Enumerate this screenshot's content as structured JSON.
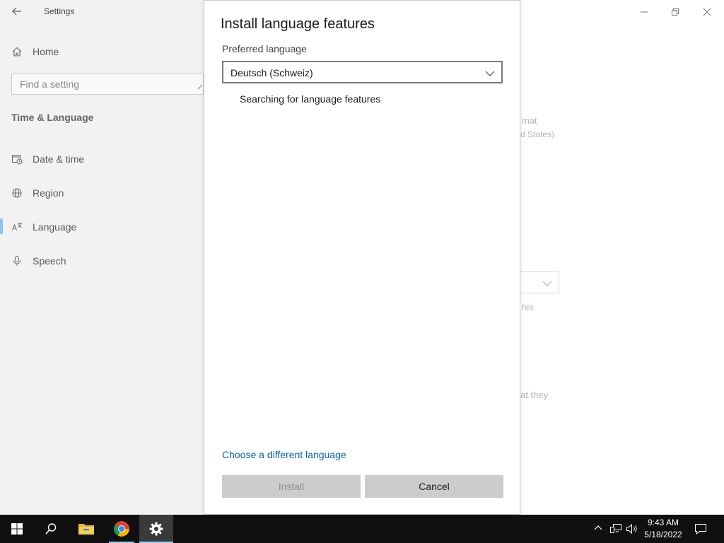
{
  "app": {
    "title": "Settings",
    "home_label": "Home",
    "search_placeholder": "Find a setting",
    "section_title": "Time & Language",
    "nav": [
      {
        "label": "Date & time",
        "icon": "calendar-clock-icon"
      },
      {
        "label": "Region",
        "icon": "globe-icon"
      },
      {
        "label": "Language",
        "icon": "language-icon"
      },
      {
        "label": "Speech",
        "icon": "microphone-icon"
      }
    ],
    "selected_nav": "Language"
  },
  "background_fragments": {
    "line1": "mat",
    "line2": "d States)",
    "line3": "his",
    "line4": "at they"
  },
  "dialog": {
    "title": "Install language features",
    "preferred_label": "Preferred language",
    "selected_language": "Deutsch (Schweiz)",
    "status_text": "Searching for language features",
    "different_language_link": "Choose a different language",
    "install_label": "Install",
    "cancel_label": "Cancel",
    "install_enabled": false
  },
  "taskbar": {
    "items": [
      "start-icon",
      "search-icon",
      "file-explorer-icon",
      "chrome-icon",
      "settings-gear-icon"
    ],
    "time": "9:43 AM",
    "date": "5/18/2022"
  },
  "colors": {
    "link": "#0063b1",
    "accent_indicator": "#8cc4f0",
    "taskbar": "#101010",
    "button": "#cccccc"
  }
}
